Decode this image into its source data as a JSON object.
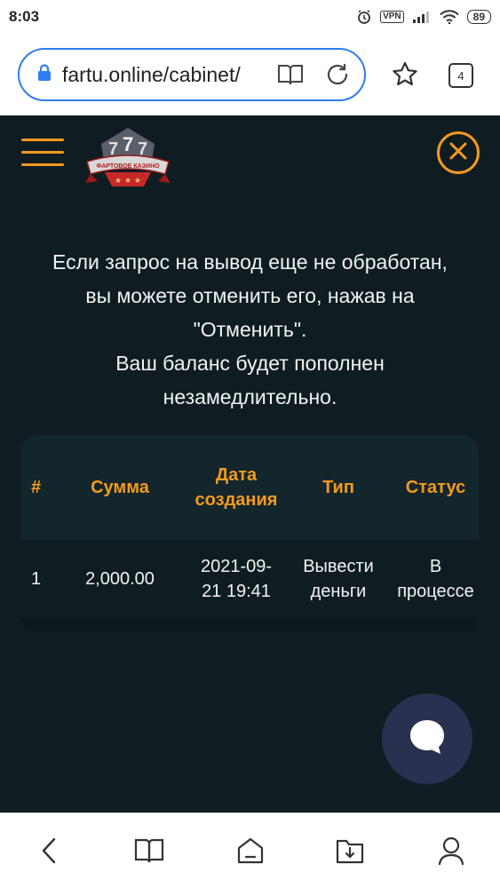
{
  "status_bar": {
    "time": "8:03",
    "icons": [
      "alarm-icon",
      "vpn-icon",
      "signal-icon",
      "wifi-icon",
      "battery-icon"
    ],
    "vpn_label": "VPN",
    "battery_level": "89"
  },
  "browser": {
    "url": "fartu.online/cabinet/",
    "tab_count": "4",
    "icons": [
      "lock-icon",
      "reader-mode-icon",
      "reload-icon",
      "star-icon",
      "tabs-icon"
    ],
    "accent_color": "#2d7ef0"
  },
  "header": {
    "logo_text": "ФАРТОВОЕ КАЗИНО",
    "icons": [
      "hamburger-menu-icon",
      "close-icon"
    ]
  },
  "info": {
    "lines": [
      "Если запрос на вывод еще не обработан,",
      "вы можете отменить его, нажав на",
      "\"Отменить\".",
      "Ваш баланс будет пополнен",
      "незамедлительно."
    ]
  },
  "withdrawals_table": {
    "columns": [
      "#",
      "Сумма",
      "Дата создания",
      "Тип",
      "Статус"
    ],
    "column_lines": {
      "date": [
        "Дата",
        "создания"
      ]
    },
    "rows": [
      {
        "num": "1",
        "amount": "2,000.00",
        "date_lines": [
          "2021-09-",
          "21 19:41"
        ],
        "type_lines": [
          "Вывести",
          "деньги"
        ],
        "status_lines": [
          "В",
          "процессе"
        ]
      }
    ]
  },
  "chat": {
    "icon": "chat-bubble-icon",
    "bg_color": "#2a3050"
  },
  "bottom_nav": {
    "icons": [
      "back-icon",
      "bookmarks-icon",
      "home-icon",
      "downloads-icon",
      "profile-icon"
    ]
  },
  "colors": {
    "page_bg": "#0f1d22",
    "accent": "#f39a1e",
    "table_header_bg": "#13262b",
    "text": "#f1f3f4"
  }
}
